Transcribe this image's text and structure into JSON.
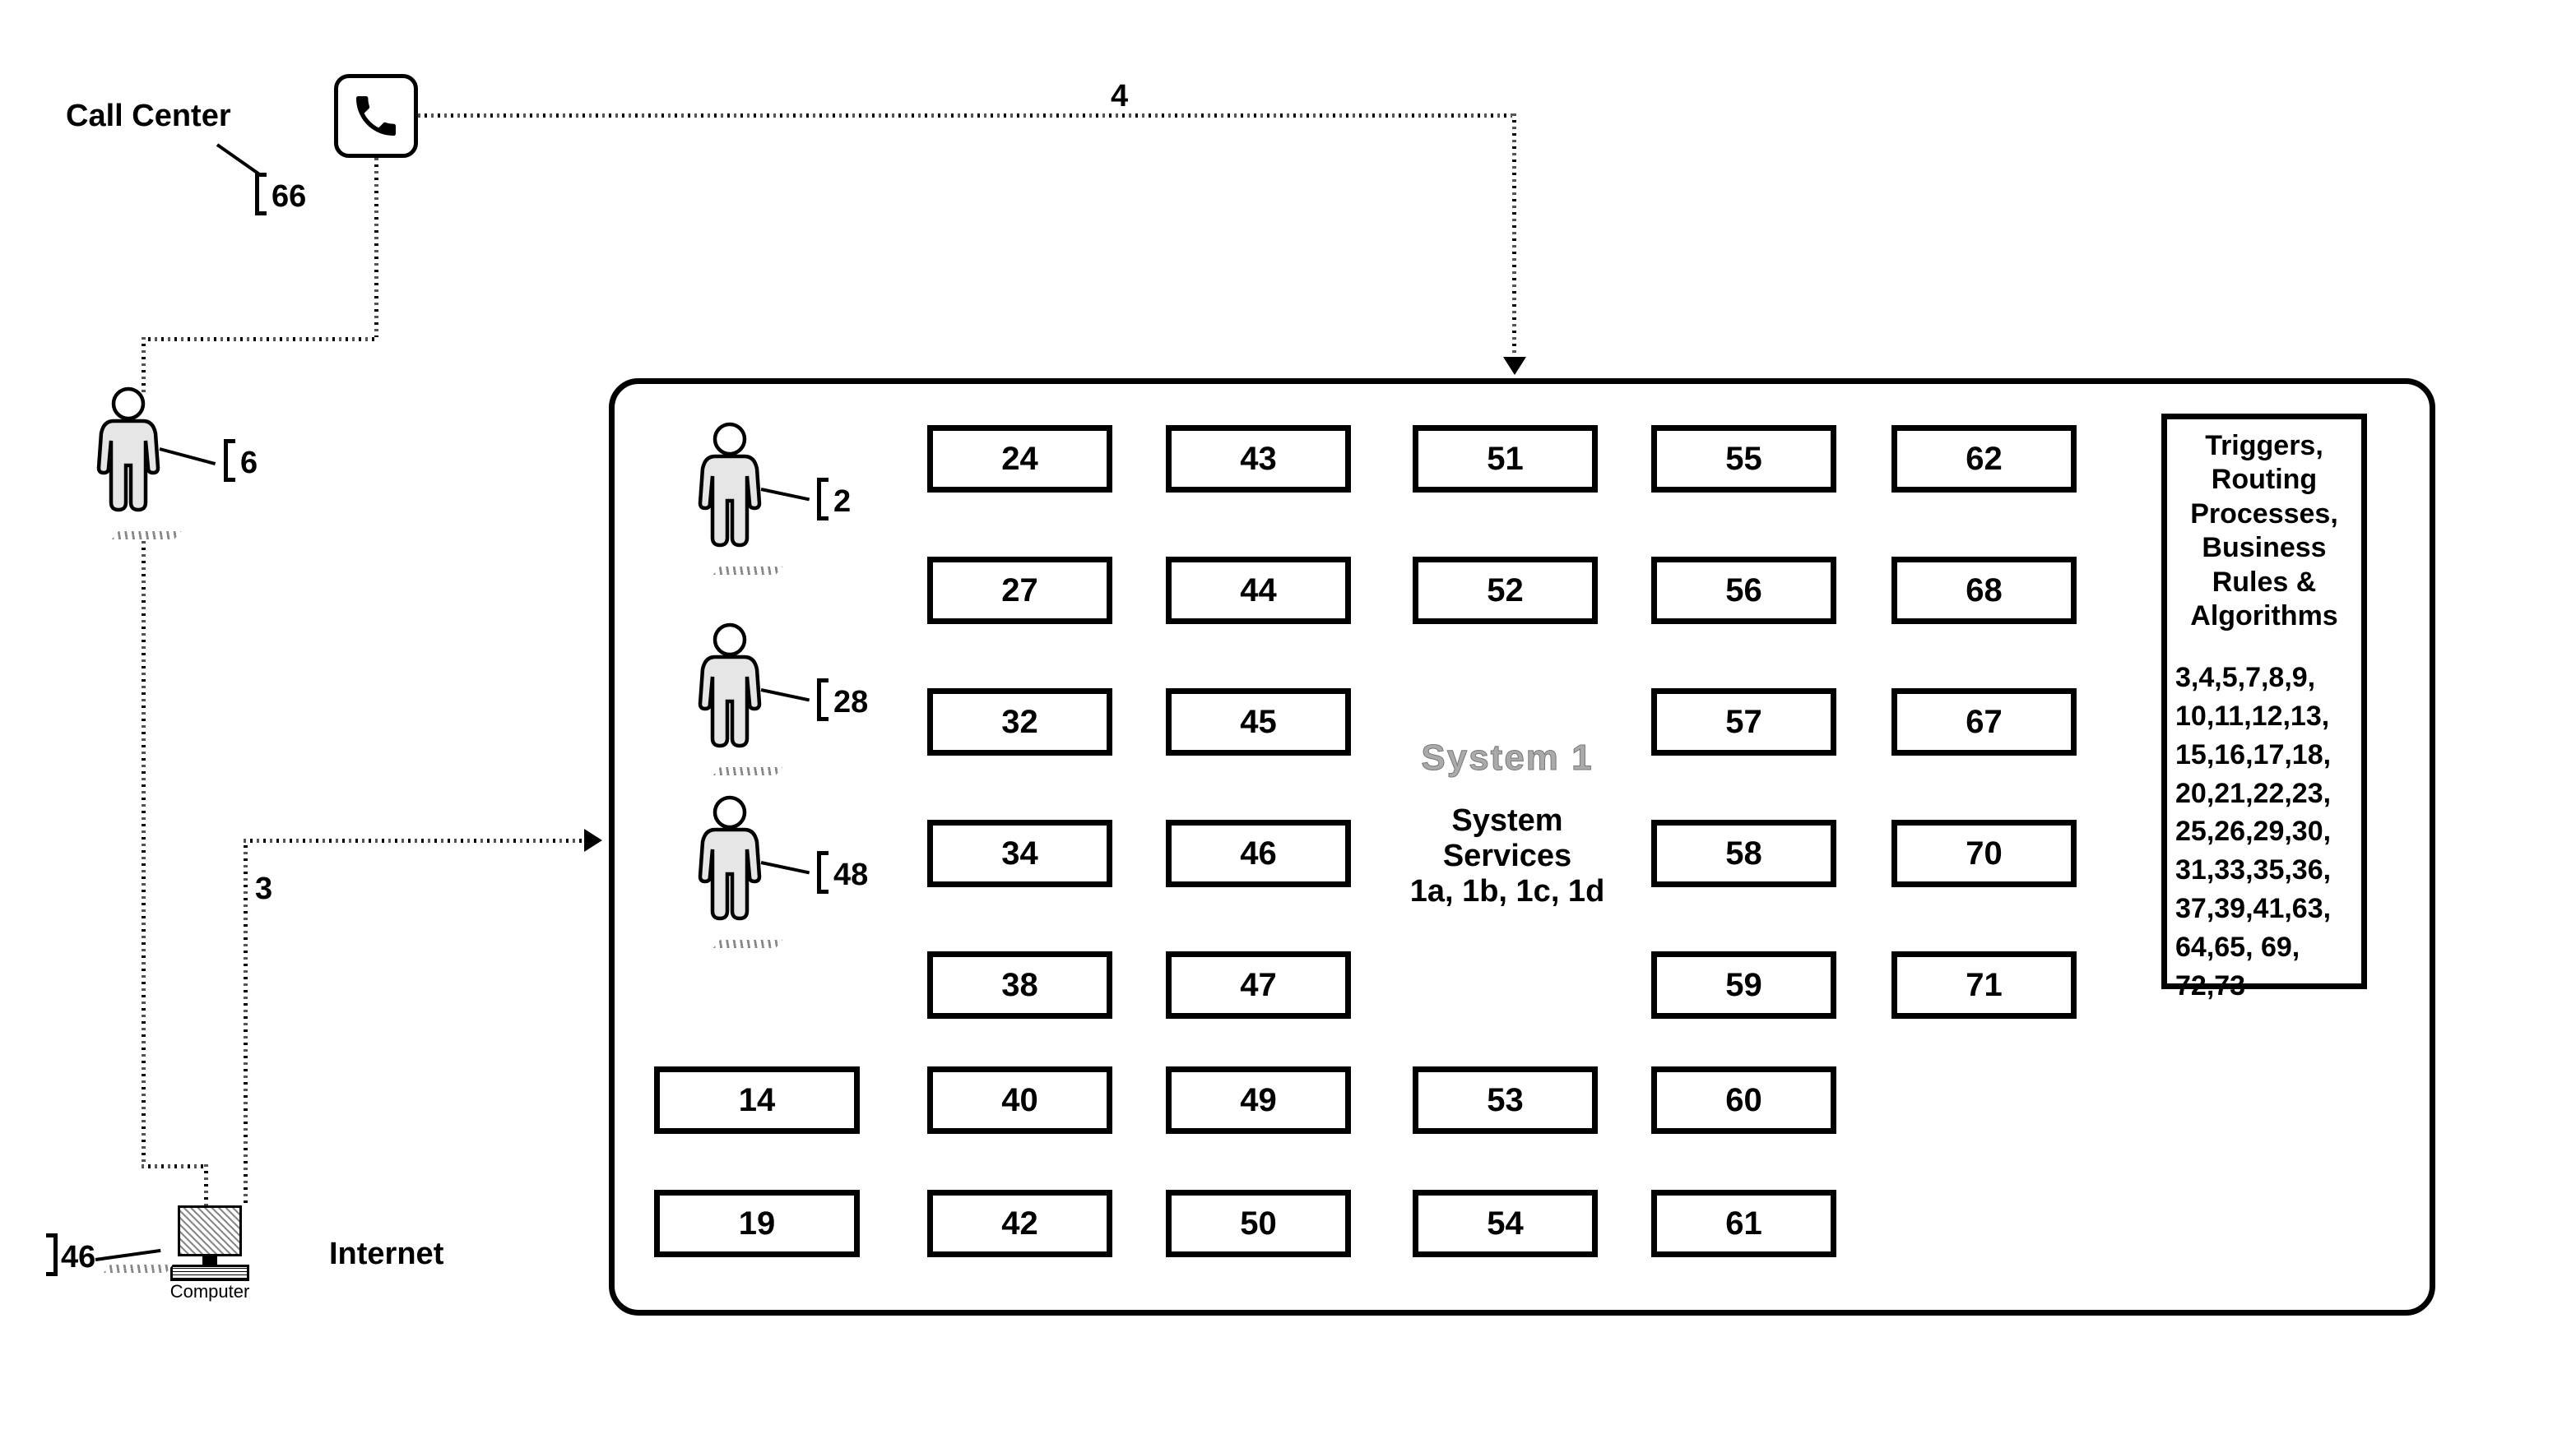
{
  "external": {
    "call_center_label": "Call Center",
    "call_center_lead": "66",
    "phone_path_lead": "4",
    "person_outside_lead": "6",
    "internet_path_lead": "3",
    "computer_label": "Computer",
    "computer_lead": "46",
    "internet_label": "Internet"
  },
  "system": {
    "title": "System 1",
    "services_label": "System Services",
    "services_sub": "1a, 1b, 1c, 1d",
    "persons": {
      "p1": "2",
      "p2": "28",
      "p3": "48"
    },
    "triggers": {
      "title": "Triggers, Routing Processes, Business Rules & Algorithms",
      "lines": [
        "3,4,5,7,8,9,",
        "10,11,12,13,",
        "15,16,17,18,",
        "20,21,22,23,",
        "25,26,29,30,",
        "31,33,35,36,",
        "37,39,41,63,",
        "64,65, 69,",
        "72,73"
      ]
    },
    "modules": {
      "c0r6": "14",
      "c0r7": "19",
      "c1r0": "24",
      "c1r1": "27",
      "c1r2": "32",
      "c1r3": "34",
      "c1r4": "38",
      "c1r6": "40",
      "c1r7": "42",
      "c2r0": "43",
      "c2r1": "44",
      "c2r2": "45",
      "c2r3": "46",
      "c2r4": "47",
      "c2r6": "49",
      "c2r7": "50",
      "c3r0": "51",
      "c3r1": "52",
      "c3r6": "53",
      "c3r7": "54",
      "c4r0": "55",
      "c4r1": "56",
      "c4r2": "57",
      "c4r3": "58",
      "c4r4": "59",
      "c4r6": "60",
      "c4r7": "61",
      "c5r0": "62",
      "c5r1": "68",
      "c5r2": "67",
      "c5r3": "70",
      "c5r4": "71"
    }
  }
}
